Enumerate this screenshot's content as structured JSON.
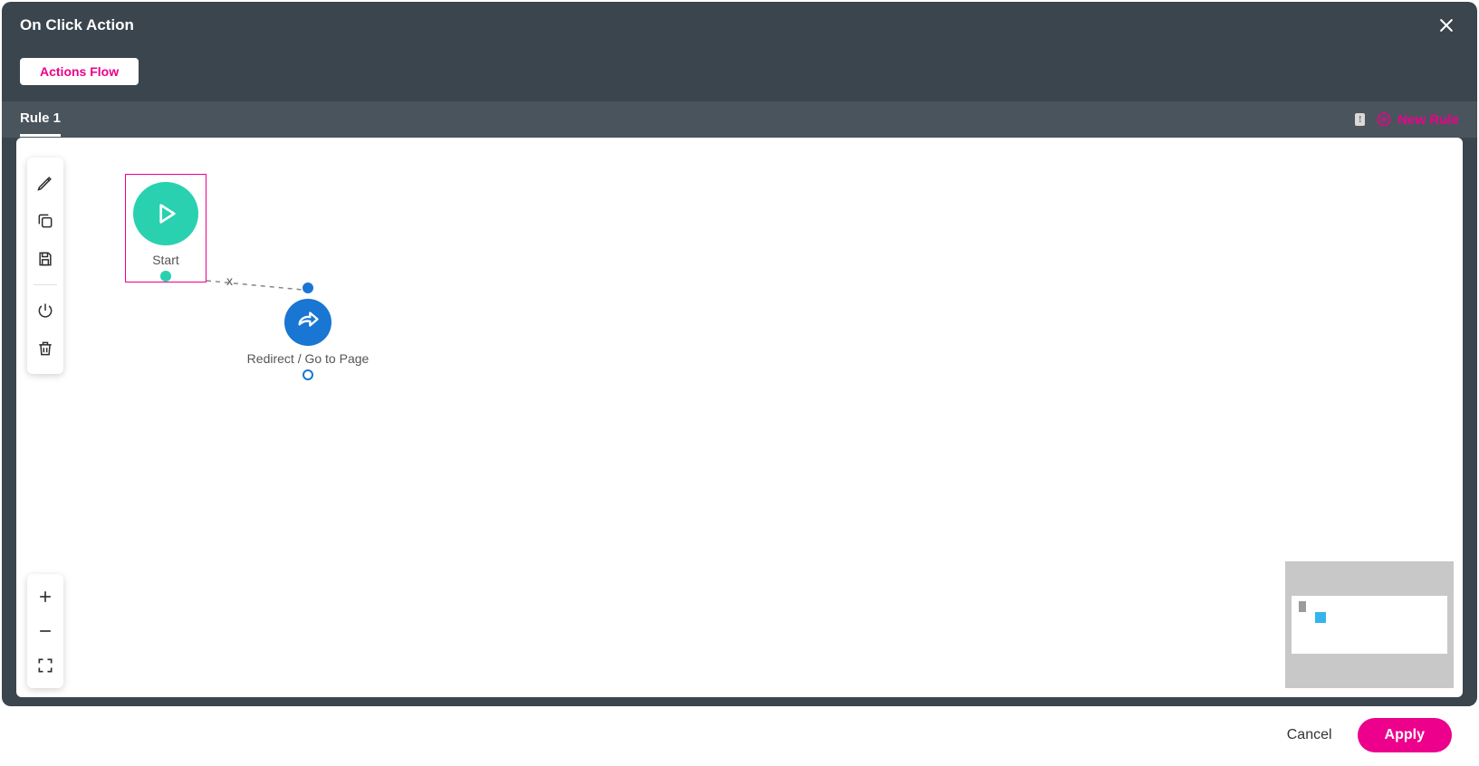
{
  "header": {
    "title": "On Click Action"
  },
  "mode": {
    "actions_flow_label": "Actions Flow"
  },
  "rules": {
    "tab_label": "Rule 1",
    "warning_indicator": "!",
    "new_rule_label": "New Rule"
  },
  "nodes": {
    "start": {
      "label": "Start"
    },
    "redirect": {
      "label": "Redirect / Go to Page"
    },
    "connector_delete_glyph": "x"
  },
  "toolbar": {
    "edit_tooltip": "Edit",
    "copy_tooltip": "Copy",
    "save_tooltip": "Save",
    "power_tooltip": "Disable",
    "delete_tooltip": "Delete"
  },
  "zoom": {
    "in_tooltip": "Zoom In",
    "out_tooltip": "Zoom Out",
    "fit_tooltip": "Fit"
  },
  "footer": {
    "cancel_label": "Cancel",
    "apply_label": "Apply"
  },
  "colors": {
    "accent_pink": "#ec008c",
    "node_teal": "#29d1b0",
    "node_blue": "#1976d2",
    "panel_bg": "#3a454e"
  }
}
